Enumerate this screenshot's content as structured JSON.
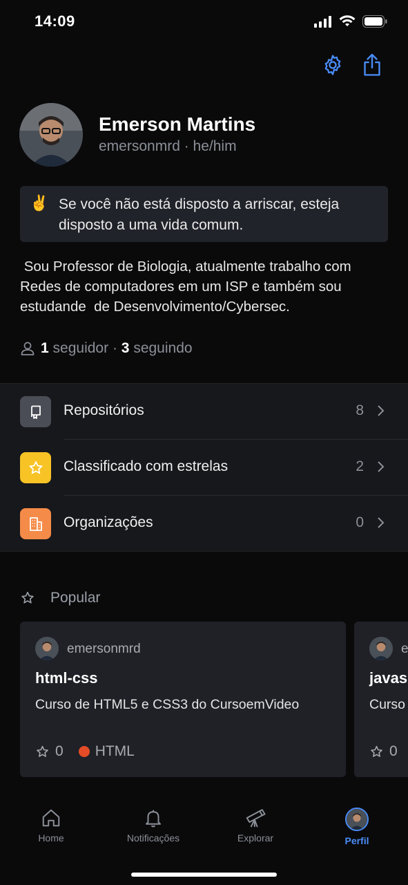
{
  "status_bar": {
    "time": "14:09"
  },
  "header": {
    "settings_icon": "gear-icon",
    "share_icon": "share-icon"
  },
  "profile": {
    "name": "Emerson Martins",
    "handle": "emersonmrd · he/him",
    "status_emoji": "✌️",
    "status_text": "Se você não está disposto a arriscar, esteja disposto a uma vida comum.",
    "bio": " Sou Professor de Biologia, atualmente trabalho com Redes de computadores em um ISP e também sou estudande  de Desenvolvimento/Cybersec.",
    "followers_count": "1",
    "followers_label": "seguidor",
    "separator": "·",
    "following_count": "3",
    "following_label": "seguindo"
  },
  "menu": [
    {
      "label": "Repositórios",
      "count": "8",
      "icon": "repo-icon",
      "color": "#4a4d55"
    },
    {
      "label": "Classificado com estrelas",
      "count": "2",
      "icon": "star-icon",
      "color": "#f7c325"
    },
    {
      "label": "Organizações",
      "count": "0",
      "icon": "organization-icon",
      "color": "#f58b48"
    }
  ],
  "popular": {
    "heading": "Popular",
    "cards": [
      {
        "owner": "emersonmrd",
        "title": "html-css",
        "description": "Curso de HTML5 e CSS3 do CursoemVideo",
        "stars": "0",
        "language": "HTML",
        "language_color": "#e34c26"
      },
      {
        "owner": "e",
        "title": "javas",
        "description": "Curso",
        "stars": "0"
      }
    ]
  },
  "tabbar": [
    {
      "label": "Home",
      "icon": "home-icon"
    },
    {
      "label": "Notificações",
      "icon": "bell-icon"
    },
    {
      "label": "Explorar",
      "icon": "telescope-icon"
    },
    {
      "label": "Perfil",
      "icon": "avatar",
      "active": true
    }
  ],
  "colors": {
    "accent": "#4a8df8",
    "background": "#0a0a0b",
    "surface": "#17181c"
  }
}
